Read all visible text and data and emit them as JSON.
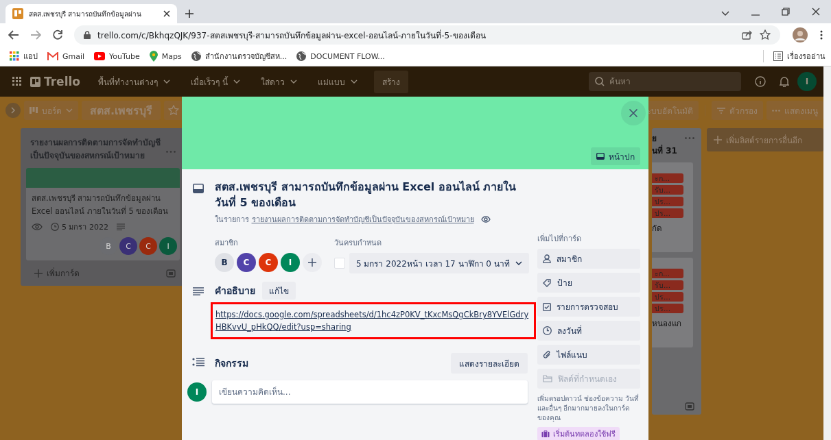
{
  "browser": {
    "tab_title": "สตส.เพชรบุรี สามารถบันทึกข้อมูลผ่าน",
    "url": "trello.com/c/BkhqzQJK/937-สตสเพชรบุรี-สามารถบันทึกข้อมูลผ่าน-excel-ออนไลน์-ภายในวันที่-5-ของเดือน",
    "bookmarks": [
      {
        "kind": "apps",
        "label": "แอป"
      },
      {
        "kind": "gmail",
        "label": "Gmail"
      },
      {
        "kind": "youtube",
        "label": "YouTube"
      },
      {
        "kind": "maps",
        "label": "Maps"
      },
      {
        "kind": "globe",
        "label": "สำนักงานตรวจบัญชีสห..."
      },
      {
        "kind": "globe",
        "label": "DOCUMENT FLOW..."
      }
    ],
    "reading_list": "เรื่องรออ่าน"
  },
  "trello_header": {
    "logo": "Trello",
    "menus": [
      "พื้นที่ทำงานต่างๆ",
      "เมื่อเร็วๆ นี้",
      "ใส่ดาว",
      "แม่แบบ"
    ],
    "create": "สร้าง",
    "search_placeholder": "ค้นหา",
    "avatar": "I"
  },
  "board_header": {
    "switcher": "บอร์ด",
    "title": "สตส.เพชรบุรี",
    "starred": false,
    "right_buttons": [
      {
        "kind": "plain",
        "label": "ะบบอัตโนมัติ"
      },
      {
        "kind": "filter",
        "label": "ตัวกรอง"
      },
      {
        "kind": "menu",
        "label": "แสดงเมนู"
      }
    ]
  },
  "left_list": {
    "title": "รายงานผลการติดตามการจัดทำบัญชีเป็นปัจจุบันของสหกรณ์เป้าหมาย",
    "card": {
      "text": "สตส.เพชรบุรี สามารถบันทึกข้อมูลผ่าน Excel ออนไลน์ ภายในวันที่ 5 ของเดือน",
      "due": "5 มกรา 2022",
      "members": [
        {
          "initial": "B",
          "color": "#6b6c70"
        },
        {
          "initial": "C",
          "color": "#3a3076"
        },
        {
          "initial": "C",
          "color": "#9a2a0e"
        },
        {
          "initial": "I",
          "color": "#0b5a3d"
        }
      ]
    },
    "add_card": "เพิ่มการ์ด"
  },
  "right_list": {
    "title_lines": [
      "ย",
      "นที่ 31"
    ],
    "cards": [
      {
        "labels": [
          "ะก...",
          "รับ...",
          "ปร...",
          "ปร..."
        ],
        "text": "กัด"
      },
      {
        "labels": [
          "ะก...",
          "รับ...",
          "ปร...",
          "ปร..."
        ],
        "text": "หนองแก"
      }
    ]
  },
  "add_list": "เพิ่มลิสต์รายการอื่นอีก",
  "modal": {
    "cover_button": "หน้าปก",
    "title": "สตส.เพชรบุรี สามารถบันทึกข้อมูลผ่าน Excel ออนไลน์ ภายในวันที่ 5 ของเดือน",
    "in_list_prefix": "ในรายการ",
    "list_link": "รายงานผลการติดตามการจัดทำบัญชีเป็นปัจจุบันของสหกรณ์เป้าหมาย",
    "members_label": "สมาชิก",
    "members": [
      {
        "initial": "B",
        "color": "#dfe1e6"
      },
      {
        "initial": "C",
        "color": "#5243aa"
      },
      {
        "initial": "C",
        "color": "#de350b"
      },
      {
        "initial": "I",
        "color": "#00875a"
      }
    ],
    "due_label": "วันครบกำหนด",
    "due": {
      "checked": false,
      "text": "5 มกรา 2022หน้า เวลา 17 นาฬิกา 0 นาที"
    },
    "description_label": "คำอธิบาย",
    "edit": "แก้ไข",
    "description_link": "https://docs.google.com/spreadsheets/d/1hc4zP0KV_tKxcMsQgCkBry8YVElGdryHBKvvU_pHkQQ/edit?usp=sharing",
    "highlighted": true,
    "activity_label": "กิจกรรม",
    "show_details": "แสดงรายละเอียด",
    "commenter": "I",
    "comment_placeholder": "เขียนความคิดเห็น...",
    "sidebar_label": "เพิ่มไปที่การ์ด",
    "actions": [
      {
        "kind": "member",
        "label": "สมาชิก",
        "disabled": false
      },
      {
        "kind": "label",
        "label": "ป้าย",
        "disabled": false
      },
      {
        "kind": "checklist",
        "label": "รายการตรวจสอบ",
        "disabled": false
      },
      {
        "kind": "date",
        "label": "ลงวันที่",
        "disabled": false
      },
      {
        "kind": "attachment",
        "label": "ไฟล์แนบ",
        "disabled": false
      },
      {
        "kind": "custom",
        "label": "ฟิลด์ที่กำหนดเอง",
        "disabled": true
      }
    ],
    "upsell": "เพิ่มดรอปดาวน์ ช่องข้อความ วันที่ และอื่นๆ อีกมากมายลงในการ์ดของคุณ",
    "trial": "เริ่มต้นทดลองใช้ฟรี"
  }
}
